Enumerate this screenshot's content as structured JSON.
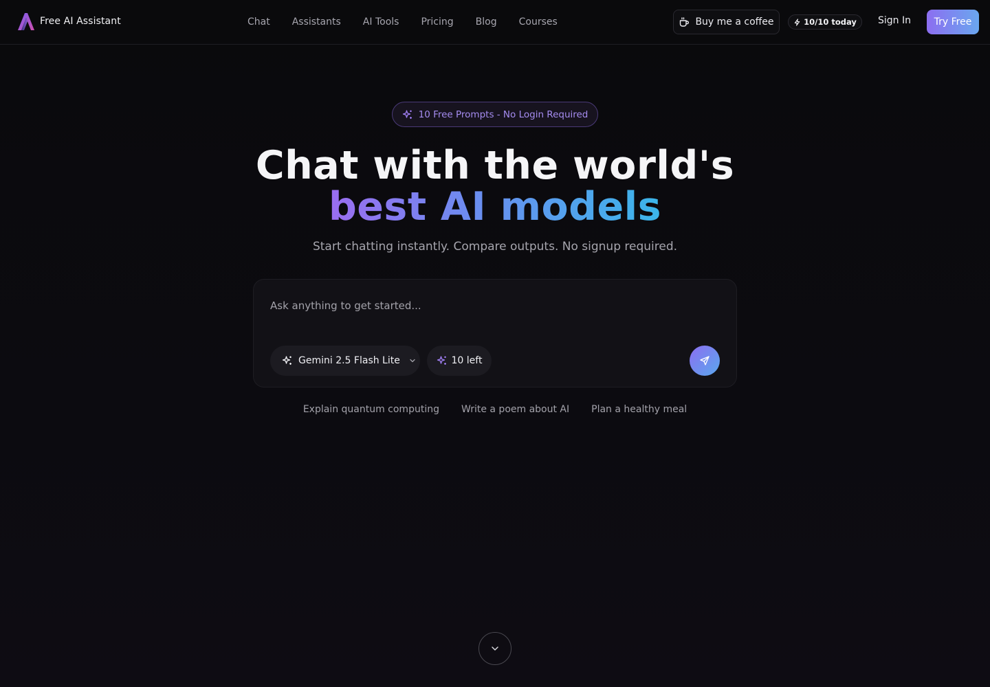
{
  "brand": {
    "name": "Free AI Assistant",
    "icon": "logo-a-icon"
  },
  "nav": {
    "items": [
      {
        "label": "Chat"
      },
      {
        "label": "Assistants"
      },
      {
        "label": "AI Tools"
      },
      {
        "label": "Pricing"
      },
      {
        "label": "Blog"
      },
      {
        "label": "Courses"
      }
    ]
  },
  "header": {
    "coffee_label": "Buy me a coffee",
    "today_badge": "10/10 today",
    "signin_label": "Sign In",
    "tryfree_label": "Try Free"
  },
  "hero": {
    "pill": "10 Free Prompts - No Login Required",
    "title_line1": "Chat with the world's",
    "title_line2": "best AI models",
    "subtitle": "Start chatting instantly. Compare outputs. No signup required."
  },
  "chat": {
    "placeholder": "Ask anything to get started...",
    "value": "",
    "model": "Gemini 2.5 Flash Lite",
    "remaining": "10 left"
  },
  "suggestions": [
    {
      "label": "Explain quantum computing"
    },
    {
      "label": "Write a poem about AI"
    },
    {
      "label": "Plan a healthy meal"
    }
  ],
  "colors": {
    "accent_purple": "#8c6ef0",
    "accent_blue": "#5aa8ee",
    "background": "#0b0a0d"
  }
}
